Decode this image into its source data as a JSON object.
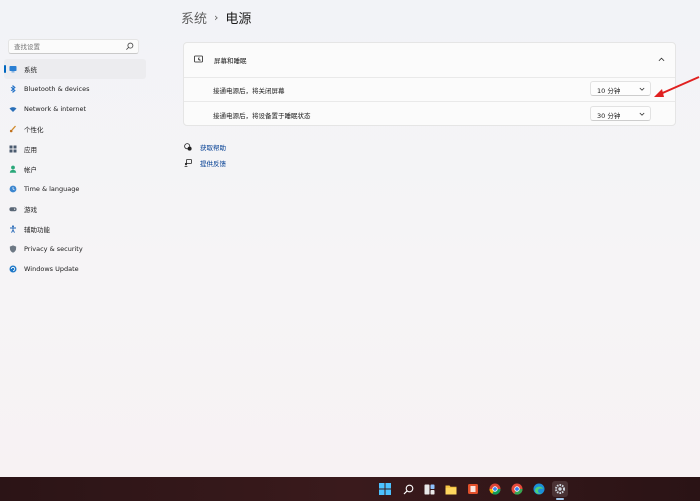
{
  "breadcrumb": {
    "parent": "系统",
    "separator": "›",
    "current": "电源"
  },
  "search": {
    "placeholder": "查找设置"
  },
  "sidebar": {
    "items": [
      {
        "label": "系统",
        "icon": "monitor-icon",
        "active": true
      },
      {
        "label": "Bluetooth & devices",
        "icon": "bluetooth-icon"
      },
      {
        "label": "Network & internet",
        "icon": "wifi-icon"
      },
      {
        "label": "个性化",
        "icon": "brush-icon"
      },
      {
        "label": "应用",
        "icon": "apps-icon"
      },
      {
        "label": "帐户",
        "icon": "person-icon"
      },
      {
        "label": "Time & language",
        "icon": "globe-clock-icon"
      },
      {
        "label": "游戏",
        "icon": "gamepad-icon"
      },
      {
        "label": "辅助功能",
        "icon": "accessibility-icon"
      },
      {
        "label": "Privacy & security",
        "icon": "shield-icon"
      },
      {
        "label": "Windows Update",
        "icon": "update-icon"
      }
    ]
  },
  "card": {
    "title": "屏幕和睡眠",
    "rows": [
      {
        "label": "接通电源后，将关闭屏幕",
        "value": "10 分钟"
      },
      {
        "label": "接通电源后，将设备置于睡眠状态",
        "value": "30 分钟"
      }
    ]
  },
  "links": {
    "help": "获取帮助",
    "feedback": "提供反馈"
  },
  "colors": {
    "accent": "#0067c0",
    "annotation": "#e02020",
    "link": "#003e92"
  },
  "taskbar": {
    "icons": [
      "start-icon",
      "search-icon",
      "task-view-icon",
      "file-explorer-icon",
      "office-icon",
      "chrome-icon",
      "chrome-alt-icon",
      "edge-icon",
      "settings-icon"
    ]
  }
}
